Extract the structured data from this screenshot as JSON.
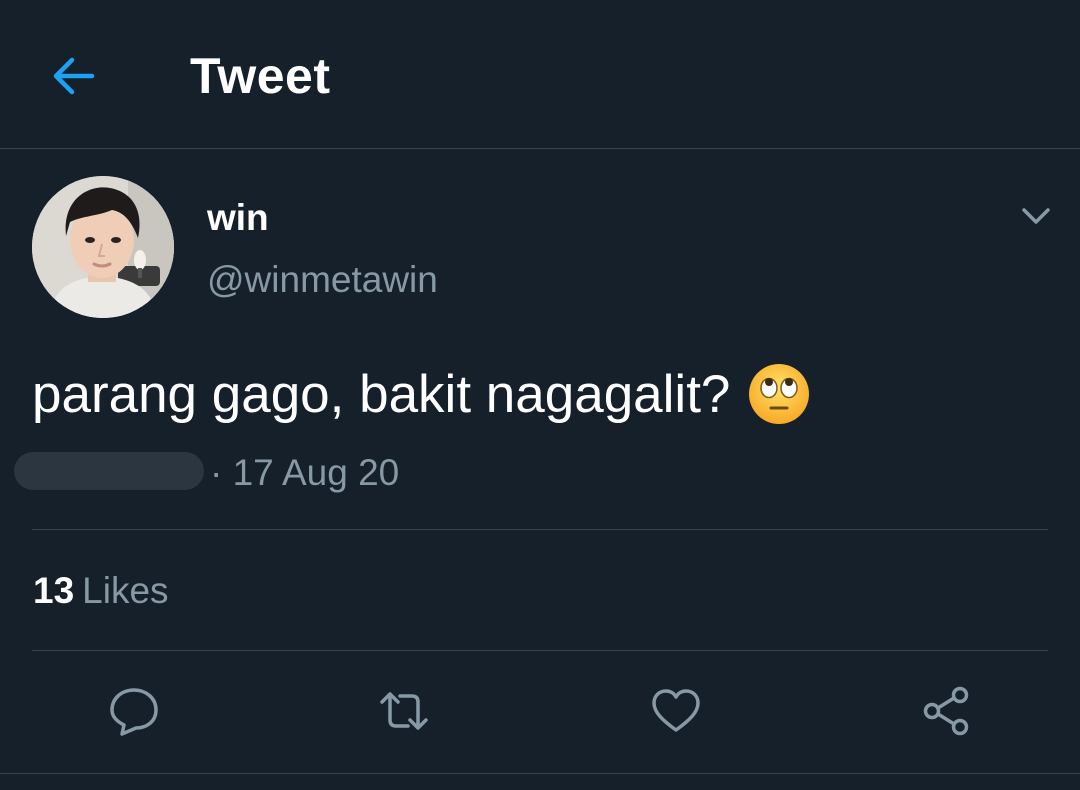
{
  "header": {
    "title": "Tweet",
    "back_icon": "arrow-left-icon",
    "accent_color": "#1da1f2"
  },
  "tweet": {
    "author": {
      "display_name": "win",
      "handle": "@winmetawin"
    },
    "text": "parang gago, bakit nagagalit?",
    "emoji": "face-with-rolling-eyes",
    "meta": {
      "date": "· 17 Aug 20"
    },
    "stats": {
      "likes_count": "13",
      "likes_label": "Likes"
    }
  },
  "actions": [
    {
      "name": "reply",
      "icon": "reply-icon"
    },
    {
      "name": "retweet",
      "icon": "retweet-icon"
    },
    {
      "name": "like",
      "icon": "heart-icon"
    },
    {
      "name": "share",
      "icon": "share-icon"
    }
  ],
  "colors": {
    "background": "#15202b",
    "divider": "#38444d",
    "secondary_text": "#8899a6",
    "primary_text": "#ffffff"
  }
}
